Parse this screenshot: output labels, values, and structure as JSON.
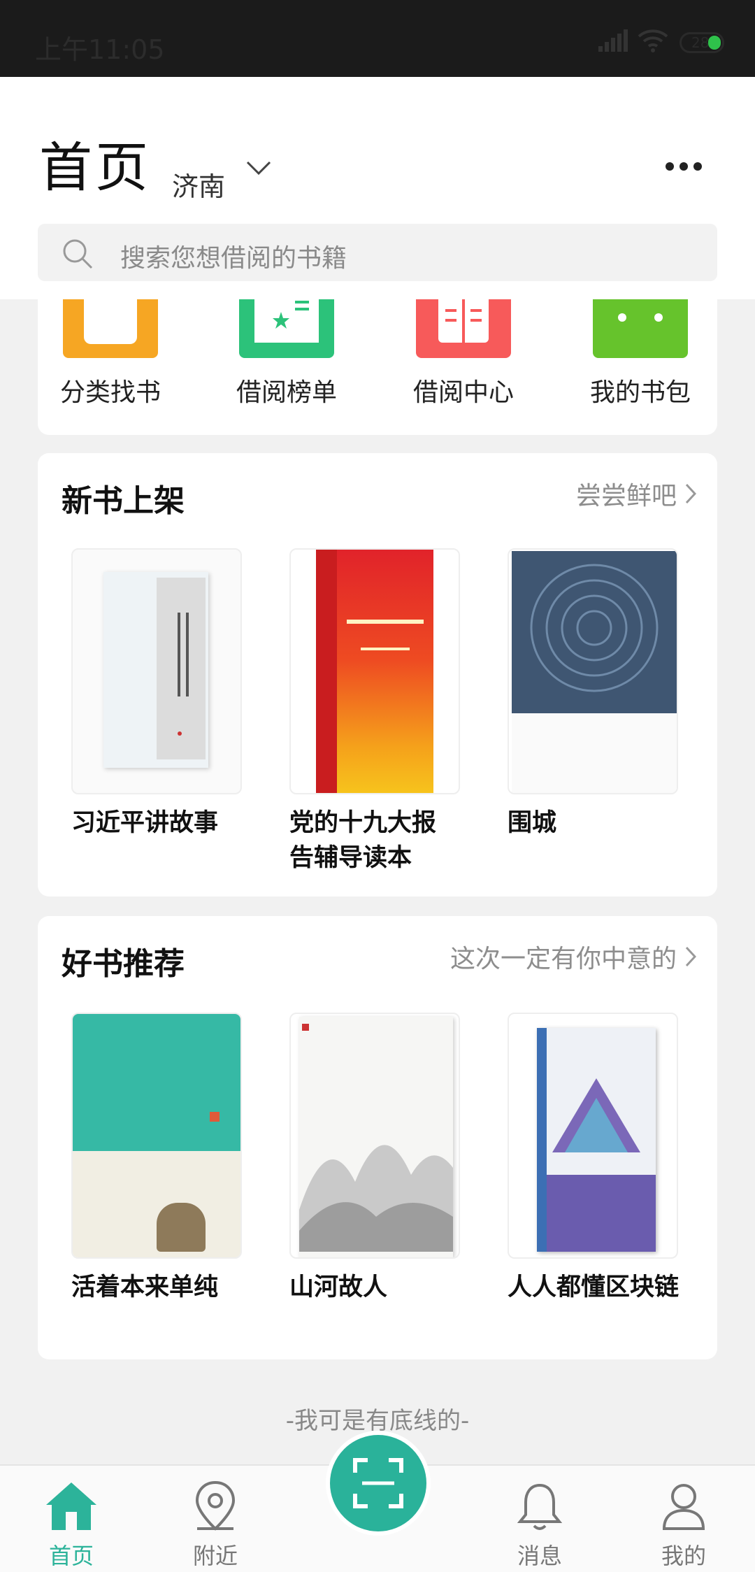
{
  "status_bar": {
    "time": "上午11:05",
    "battery": "28"
  },
  "header": {
    "title": "首页",
    "city": "济南",
    "search_placeholder": "搜索您想借阅的书籍"
  },
  "quick_menu": [
    {
      "label": "分类找书",
      "color": "#f6a623",
      "icon": "category-icon"
    },
    {
      "label": "借阅榜单",
      "color": "#2cc27a",
      "icon": "ranking-icon"
    },
    {
      "label": "借阅中心",
      "color": "#f75a5a",
      "icon": "open-book-icon"
    },
    {
      "label": "我的书包",
      "color": "#66c32c",
      "icon": "bag-icon"
    }
  ],
  "new_books": {
    "title": "新书上架",
    "more": "尝尝鲜吧",
    "items": [
      {
        "title": "习近平讲故事"
      },
      {
        "title": "党的十九大报告辅导读本"
      },
      {
        "title": "围城"
      }
    ]
  },
  "recommended": {
    "title": "好书推荐",
    "more": "这次一定有你中意的",
    "items": [
      {
        "title": "活着本来单纯"
      },
      {
        "title": "山河故人"
      },
      {
        "title": "人人都懂区块链"
      }
    ]
  },
  "footer_note": "-我可是有底线的-",
  "tabbar": {
    "home": "首页",
    "nearby": "附近",
    "messages": "消息",
    "mine": "我的"
  },
  "colors": {
    "accent": "#2cb39a"
  }
}
